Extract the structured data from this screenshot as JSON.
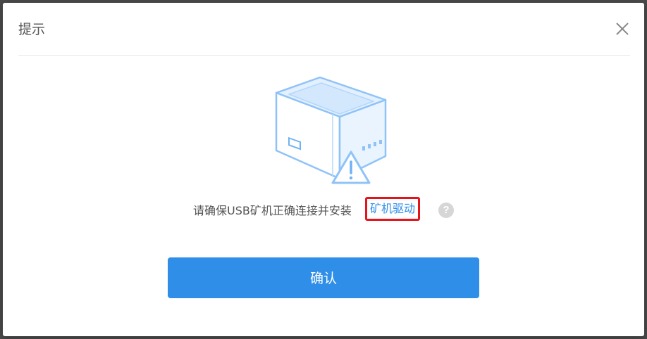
{
  "dialog": {
    "title": "提示",
    "close_icon": "close-icon"
  },
  "illustration": {
    "icon": "usb-miner-device-warning-icon"
  },
  "message": {
    "text": "请确保USB矿机正确连接并安装",
    "link_label": "矿机驱动",
    "help_icon_glyph": "?"
  },
  "actions": {
    "confirm_label": "确认"
  },
  "colors": {
    "primary": "#2f8ee8",
    "highlight_border": "#e5141b",
    "text": "#555555"
  }
}
